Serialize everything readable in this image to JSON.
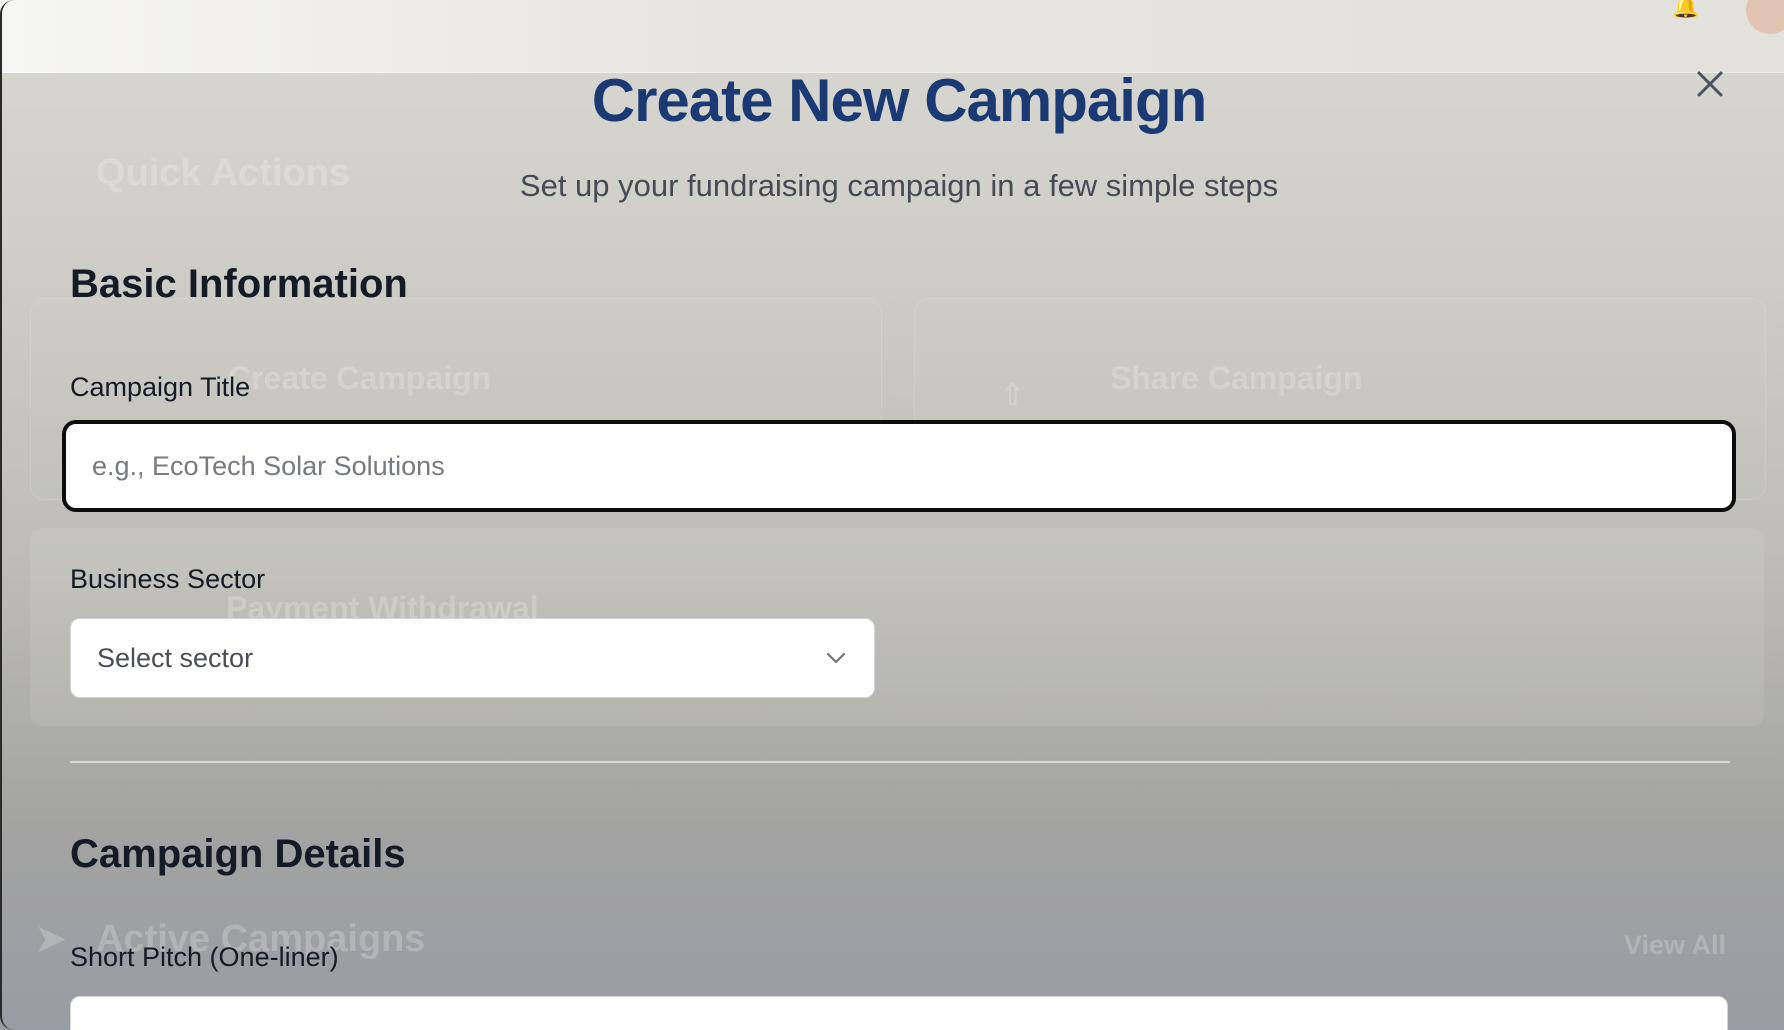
{
  "background": {
    "quick_actions_heading": "Quick Actions",
    "create_campaign_card": "Create Campaign",
    "share_campaign_card": "Share Campaign",
    "payment_withdrawal_card": "Payment Withdrawal",
    "active_campaigns_heading": "Active Campaigns",
    "view_all_link": "View All"
  },
  "modal": {
    "title": "Create New Campaign",
    "subtitle": "Set up your fundraising campaign in a few simple steps",
    "close_icon": "close-icon",
    "basic_info": {
      "heading": "Basic Information",
      "campaign_title_label": "Campaign Title",
      "campaign_title_placeholder": "e.g., EcoTech Solar Solutions",
      "business_sector_label": "Business Sector",
      "business_sector_value": "Select sector"
    },
    "campaign_details": {
      "heading": "Campaign Details",
      "short_pitch_label": "Short Pitch (One-liner)"
    }
  },
  "colors": {
    "title": "#1b3a73",
    "heading": "#141a26",
    "focus_ring": "#0d0d0d"
  }
}
